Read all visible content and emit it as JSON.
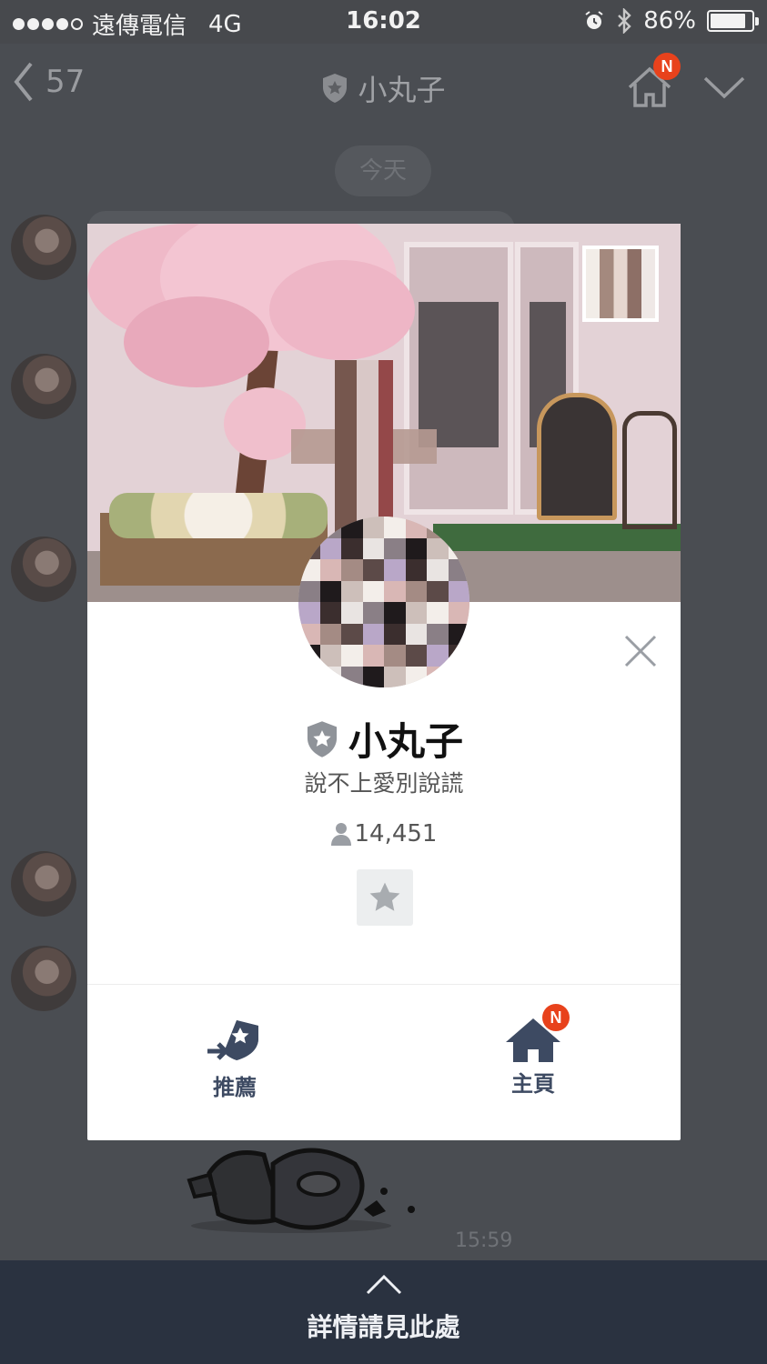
{
  "status_bar": {
    "carrier": "遠傳電信",
    "network": "4G",
    "time": "16:02",
    "battery_percent": "86%",
    "battery_level": 0.86
  },
  "chat_header": {
    "unread_count": "57",
    "title": "小丸子",
    "home_badge": "N"
  },
  "chat": {
    "date_label": "今天",
    "message_time": "15:59"
  },
  "profile": {
    "name": "小丸子",
    "status_message": "說不上愛別說謊",
    "friend_count": "14,451",
    "actions": {
      "recommend_label": "推薦",
      "home_label": "主頁",
      "home_badge": "N"
    }
  },
  "bottom_banner": {
    "label": "詳情請見此處"
  },
  "colors": {
    "overlay_bg": "#4a4d52",
    "banner_bg": "#2a3240",
    "badge": "#e8421c",
    "action_icon": "#3d4a62"
  },
  "icons": [
    "back-chevron-icon",
    "official-shield-icon",
    "home-icon",
    "chevron-down-icon",
    "close-icon",
    "person-icon",
    "star-icon",
    "recommend-shield-icon",
    "chevron-up-icon"
  ]
}
